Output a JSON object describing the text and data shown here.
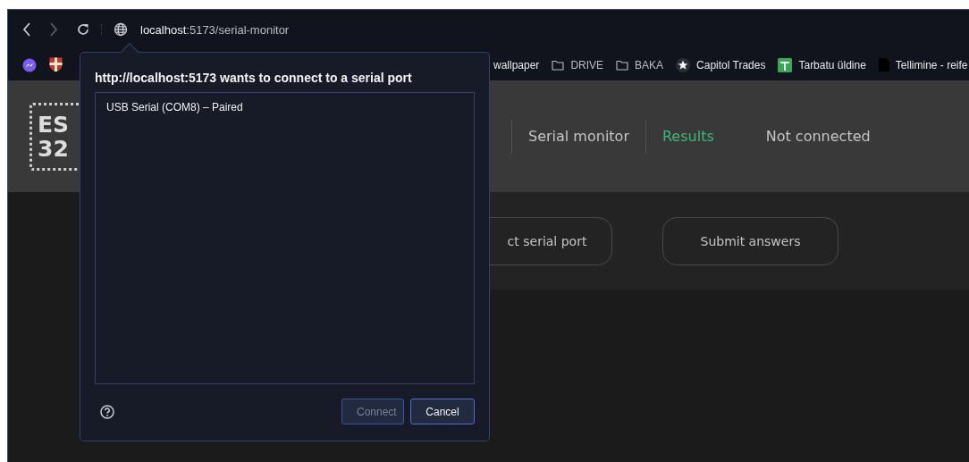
{
  "toolbar": {
    "back_disabled": false,
    "forward_disabled": true,
    "url_host": "localhost",
    "url_rest": ":5173/serial-monitor"
  },
  "bookmarks": [
    {
      "kind": "messenger"
    },
    {
      "kind": "shield"
    },
    {
      "kind": "plain",
      "label": "wallpaper"
    },
    {
      "kind": "folder",
      "label": "DRIVE"
    },
    {
      "kind": "folder",
      "label": "BAKA"
    },
    {
      "kind": "star",
      "label": "Capitol Trades"
    },
    {
      "kind": "sheet",
      "label": "Tarbatu üldine"
    },
    {
      "kind": "doc",
      "label": "Tellimine - reife"
    }
  ],
  "header": {
    "logo_lines": [
      "ES",
      "32"
    ],
    "nav": [
      {
        "label": "Serial monitor",
        "selected": false
      },
      {
        "label": "Results",
        "selected": true
      }
    ],
    "status": "Not connected"
  },
  "actions": [
    {
      "label": "ct serial port"
    },
    {
      "label": "Submit answers"
    }
  ],
  "dialog": {
    "title": "http://localhost:5173 wants to connect to a serial port",
    "ports": [
      {
        "label": "USB Serial (COM8) – Paired",
        "selected": false
      }
    ],
    "buttons": [
      {
        "label": "Connect",
        "disabled": true
      },
      {
        "label": "Cancel",
        "disabled": false
      }
    ]
  }
}
